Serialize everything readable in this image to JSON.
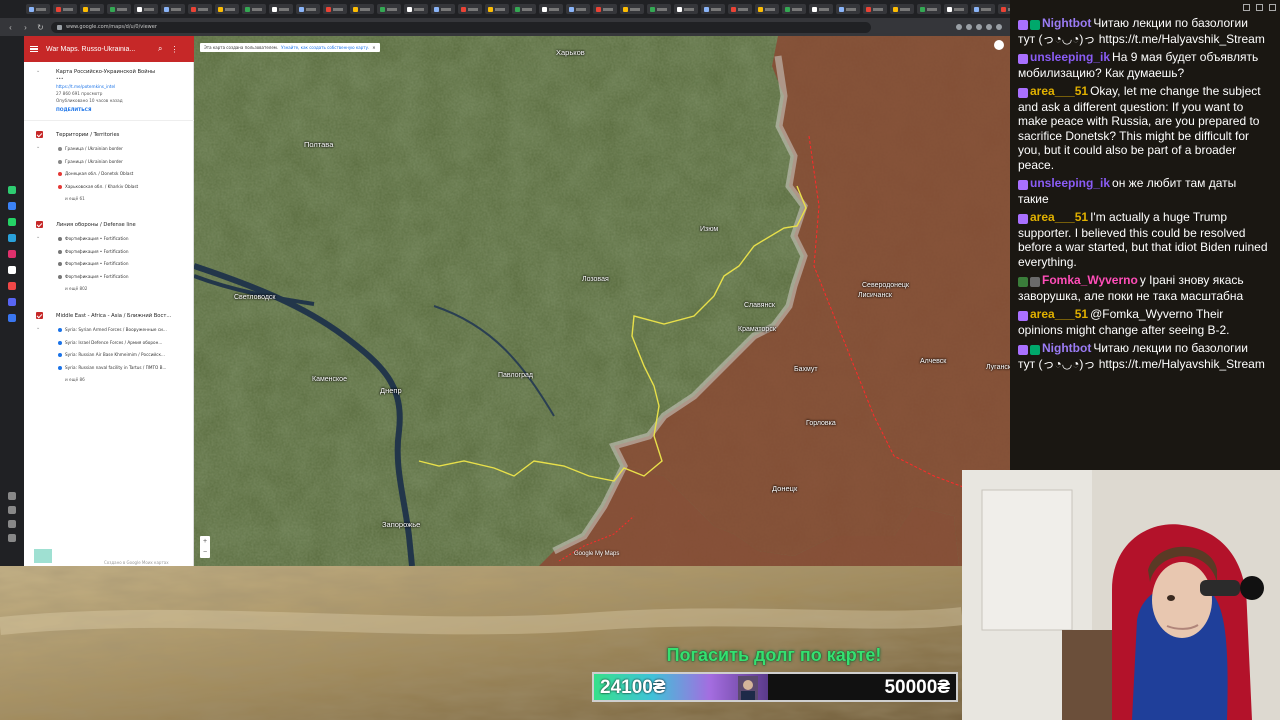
{
  "browser": {
    "url": "www.google.com/maps/d/u/0/viewer",
    "tab_count": 54
  },
  "sidebar": {
    "title": "War Maps. Russo-Ukrainia...",
    "map_title": "Карта Российско-Украинской Войны",
    "map_title_suffix": "•••",
    "link": "https://t.me/potemkins_intel",
    "views": "27 860 691 просмотр",
    "published": "Опубликовано 10 часов назад",
    "share_label": "ПОДЕЛИТЬСЯ",
    "layers": [
      {
        "name": "Территории / Territories",
        "items": [
          "Граница / Ukrainian border",
          "Граница / Ukrainian border",
          "Донецкая обл. / Donetsk Oblast",
          "Харьковская обл. / Kharkiv Oblast"
        ],
        "more": "и ещё 61"
      },
      {
        "name": "Линия обороны / Defense line",
        "items": [
          "Фортификация • Fortification",
          "Фортификация • Fortification",
          "Фортификация • Fortification",
          "Фортификация • Fortification"
        ],
        "more": "и ещё 802"
      },
      {
        "name": "Middle East - Africa - Asia / Ближний Вост...",
        "items": [
          "Syria: Syrian Armed Forces / Вооруженные си...",
          "Syria: Israel Defence Forces / Армия оборон...",
          "Syria: Russian Air Base Khmeimim / Российск...",
          "Syria: Russian naval facility in Tartus / ПМТО В..."
        ],
        "more": "и ещё 86"
      }
    ],
    "footer": "Создано в Google Моих картах"
  },
  "map": {
    "notice_text": "Эта карта создана пользователем.",
    "notice_link": "Узнайте, как создать собственную карту.",
    "cities": [
      {
        "name": "Харьков",
        "big": true
      },
      {
        "name": "Полтава",
        "big": true
      },
      {
        "name": "Днепр",
        "big": true
      },
      {
        "name": "Запорожье",
        "big": true
      },
      {
        "name": "Донецк",
        "big": true
      },
      {
        "name": "Краматорск",
        "big": false
      },
      {
        "name": "Славянск",
        "big": false
      },
      {
        "name": "Павлоград",
        "big": false
      },
      {
        "name": "Каменское",
        "big": false
      },
      {
        "name": "Горловка",
        "big": false
      },
      {
        "name": "Алчевск",
        "big": false
      },
      {
        "name": "Северодонецк",
        "big": false
      },
      {
        "name": "Лисичанск",
        "big": false
      },
      {
        "name": "Изюм",
        "big": false
      },
      {
        "name": "Лозовая",
        "big": false
      },
      {
        "name": "Светловодск",
        "big": false
      },
      {
        "name": "Бахмут",
        "big": false
      },
      {
        "name": "Луганск",
        "big": false
      }
    ],
    "google_logo": "Google My Maps",
    "zoom_in": "+",
    "zoom_out": "−"
  },
  "chat": {
    "messages": [
      {
        "user": "Nightbot",
        "color": "#9b7cf5",
        "badges": [
          "#a970ff",
          "#00a86b"
        ],
        "text": "Читаю лекции по базологии тут (っ◔◡◔)っ https://t.me/Halyavshik_Stream"
      },
      {
        "user": "unsleeping_ik",
        "color": "#8a5cf5",
        "badges": [
          "#a970ff"
        ],
        "text": "На 9 мая будет объявлять мобилизацию? Как думаешь?"
      },
      {
        "user": "area___51",
        "color": "#e0b000",
        "badges": [
          "#a970ff"
        ],
        "text": "Okay, let me change the subject and ask a different question: If you want to make peace with Russia, are you prepared to sacrifice Donetsk? This might be difficult for you, but it could also be part of a broader peace."
      },
      {
        "user": "unsleeping_ik",
        "color": "#8a5cf5",
        "badges": [
          "#a970ff"
        ],
        "text": "он же любит там даты такие"
      },
      {
        "user": "area___51",
        "color": "#e0b000",
        "badges": [
          "#a970ff"
        ],
        "text": "I'm actually a huge Trump supporter. I believed this could be resolved before a war started, but that idiot Biden ruined everything."
      },
      {
        "user": "Fomka_Wyverno",
        "color": "#ff4db8",
        "badges": [
          "#3a7d3a",
          "#6a6a6a"
        ],
        "text": "у Ірані знову якась заворушка, але поки не така масштабна"
      },
      {
        "user": "area___51",
        "color": "#e0b000",
        "badges": [
          "#a970ff"
        ],
        "text": "@Fomka_Wyverno Their opinions might change after seeing B-2."
      },
      {
        "user": "Nightbot",
        "color": "#9b7cf5",
        "badges": [
          "#a970ff",
          "#00a86b"
        ],
        "text": "Читаю лекции по базологии тут (っ◔◡◔)っ https://t.me/Halyavshik_Stream"
      }
    ]
  },
  "donation": {
    "title": "Погасить долг по карте!",
    "current": "24100₴",
    "goal": "50000₴",
    "progress": 0.482
  },
  "colors": {
    "sidebar_header": "#c62828",
    "occupied": "#8a4a34",
    "front_line": "#e8e04a",
    "donation_title": "#35e070"
  }
}
